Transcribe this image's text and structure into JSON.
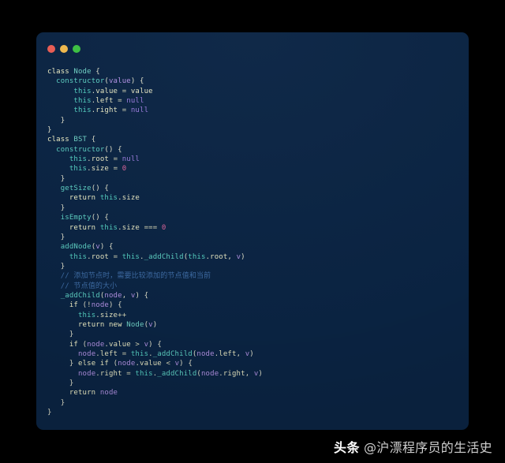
{
  "window": {
    "background_color": "#0b2545",
    "page_background_color": "#000000",
    "traffic_lights": [
      {
        "name": "close",
        "color": "#ef5f56"
      },
      {
        "name": "minimize",
        "color": "#f5bd4f"
      },
      {
        "name": "maximize",
        "color": "#3ec544"
      }
    ]
  },
  "editor": {
    "language": "javascript",
    "theme_colors": {
      "keyword": "#f2f2c8",
      "class_name": "#72d5c8",
      "function": "#5fd3c6",
      "this_object": "#56d3c4",
      "property": "#e9e9c4",
      "parameter": "#b694e8",
      "literal_null": "#9d7ee0",
      "number": "#e2689f",
      "comment": "#3f6ea8",
      "punctuation": "#e2e2cc"
    },
    "lines": [
      {
        "n": 1,
        "tokens": [
          {
            "t": "class",
            "c": "kw"
          },
          {
            "t": " ",
            "c": "plain"
          },
          {
            "t": "Node",
            "c": "cls"
          },
          {
            "t": " ",
            "c": "plain"
          },
          {
            "t": "{",
            "c": "punc"
          }
        ]
      },
      {
        "n": 2,
        "tokens": [
          {
            "t": "  ",
            "c": "plain"
          },
          {
            "t": "constructor",
            "c": "fn"
          },
          {
            "t": "(",
            "c": "punc"
          },
          {
            "t": "value",
            "c": "param"
          },
          {
            "t": ")",
            "c": "punc"
          },
          {
            "t": " ",
            "c": "plain"
          },
          {
            "t": "{",
            "c": "punc"
          }
        ]
      },
      {
        "n": 3,
        "tokens": [
          {
            "t": "      ",
            "c": "plain"
          },
          {
            "t": "this",
            "c": "obj"
          },
          {
            "t": ".",
            "c": "punc"
          },
          {
            "t": "value",
            "c": "prop"
          },
          {
            "t": " ",
            "c": "plain"
          },
          {
            "t": "=",
            "c": "op"
          },
          {
            "t": " ",
            "c": "plain"
          },
          {
            "t": "value",
            "c": "prop"
          }
        ]
      },
      {
        "n": 4,
        "tokens": [
          {
            "t": "      ",
            "c": "plain"
          },
          {
            "t": "this",
            "c": "obj"
          },
          {
            "t": ".",
            "c": "punc"
          },
          {
            "t": "left",
            "c": "prop"
          },
          {
            "t": " ",
            "c": "plain"
          },
          {
            "t": "=",
            "c": "op"
          },
          {
            "t": " ",
            "c": "plain"
          },
          {
            "t": "null",
            "c": "lit"
          }
        ]
      },
      {
        "n": 5,
        "tokens": [
          {
            "t": "      ",
            "c": "plain"
          },
          {
            "t": "this",
            "c": "obj"
          },
          {
            "t": ".",
            "c": "punc"
          },
          {
            "t": "right",
            "c": "prop"
          },
          {
            "t": " ",
            "c": "plain"
          },
          {
            "t": "=",
            "c": "op"
          },
          {
            "t": " ",
            "c": "plain"
          },
          {
            "t": "null",
            "c": "lit"
          }
        ]
      },
      {
        "n": 6,
        "tokens": [
          {
            "t": "   }",
            "c": "punc"
          }
        ]
      },
      {
        "n": 7,
        "tokens": [
          {
            "t": "}",
            "c": "punc"
          }
        ]
      },
      {
        "n": 8,
        "tokens": [
          {
            "t": "class",
            "c": "kw"
          },
          {
            "t": " ",
            "c": "plain"
          },
          {
            "t": "BST",
            "c": "cls"
          },
          {
            "t": " ",
            "c": "plain"
          },
          {
            "t": "{",
            "c": "punc"
          }
        ]
      },
      {
        "n": 9,
        "tokens": [
          {
            "t": "  ",
            "c": "plain"
          },
          {
            "t": "constructor",
            "c": "fn"
          },
          {
            "t": "(",
            "c": "punc"
          },
          {
            "t": ")",
            "c": "punc"
          },
          {
            "t": " ",
            "c": "plain"
          },
          {
            "t": "{",
            "c": "punc"
          }
        ]
      },
      {
        "n": 10,
        "tokens": [
          {
            "t": "     ",
            "c": "plain"
          },
          {
            "t": "this",
            "c": "obj"
          },
          {
            "t": ".",
            "c": "punc"
          },
          {
            "t": "root",
            "c": "prop"
          },
          {
            "t": " ",
            "c": "plain"
          },
          {
            "t": "=",
            "c": "op"
          },
          {
            "t": " ",
            "c": "plain"
          },
          {
            "t": "null",
            "c": "lit"
          }
        ]
      },
      {
        "n": 11,
        "tokens": [
          {
            "t": "     ",
            "c": "plain"
          },
          {
            "t": "this",
            "c": "obj"
          },
          {
            "t": ".",
            "c": "punc"
          },
          {
            "t": "size",
            "c": "prop"
          },
          {
            "t": " ",
            "c": "plain"
          },
          {
            "t": "=",
            "c": "op"
          },
          {
            "t": " ",
            "c": "plain"
          },
          {
            "t": "0",
            "c": "num"
          }
        ]
      },
      {
        "n": 12,
        "tokens": [
          {
            "t": "   }",
            "c": "punc"
          }
        ]
      },
      {
        "n": 13,
        "tokens": [
          {
            "t": "   ",
            "c": "plain"
          },
          {
            "t": "getSize",
            "c": "fn"
          },
          {
            "t": "()",
            "c": "punc"
          },
          {
            "t": " ",
            "c": "plain"
          },
          {
            "t": "{",
            "c": "punc"
          }
        ]
      },
      {
        "n": 14,
        "tokens": [
          {
            "t": "     ",
            "c": "plain"
          },
          {
            "t": "return",
            "c": "kw"
          },
          {
            "t": " ",
            "c": "plain"
          },
          {
            "t": "this",
            "c": "obj"
          },
          {
            "t": ".",
            "c": "punc"
          },
          {
            "t": "size",
            "c": "prop"
          }
        ]
      },
      {
        "n": 15,
        "tokens": [
          {
            "t": "   }",
            "c": "punc"
          }
        ]
      },
      {
        "n": 16,
        "tokens": [
          {
            "t": "   ",
            "c": "plain"
          },
          {
            "t": "isEmpty",
            "c": "fn"
          },
          {
            "t": "()",
            "c": "punc"
          },
          {
            "t": " ",
            "c": "plain"
          },
          {
            "t": "{",
            "c": "punc"
          }
        ]
      },
      {
        "n": 17,
        "tokens": [
          {
            "t": "     ",
            "c": "plain"
          },
          {
            "t": "return",
            "c": "kw"
          },
          {
            "t": " ",
            "c": "plain"
          },
          {
            "t": "this",
            "c": "obj"
          },
          {
            "t": ".",
            "c": "punc"
          },
          {
            "t": "size",
            "c": "prop"
          },
          {
            "t": " ",
            "c": "plain"
          },
          {
            "t": "===",
            "c": "op"
          },
          {
            "t": " ",
            "c": "plain"
          },
          {
            "t": "0",
            "c": "num"
          }
        ]
      },
      {
        "n": 18,
        "tokens": [
          {
            "t": "   }",
            "c": "punc"
          }
        ]
      },
      {
        "n": 19,
        "tokens": [
          {
            "t": "   ",
            "c": "plain"
          },
          {
            "t": "addNode",
            "c": "fn"
          },
          {
            "t": "(",
            "c": "punc"
          },
          {
            "t": "v",
            "c": "param"
          },
          {
            "t": ")",
            "c": "punc"
          },
          {
            "t": " ",
            "c": "plain"
          },
          {
            "t": "{",
            "c": "punc"
          }
        ]
      },
      {
        "n": 20,
        "tokens": [
          {
            "t": "     ",
            "c": "plain"
          },
          {
            "t": "this",
            "c": "obj"
          },
          {
            "t": ".",
            "c": "punc"
          },
          {
            "t": "root",
            "c": "prop"
          },
          {
            "t": " ",
            "c": "plain"
          },
          {
            "t": "=",
            "c": "op"
          },
          {
            "t": " ",
            "c": "plain"
          },
          {
            "t": "this",
            "c": "obj"
          },
          {
            "t": ".",
            "c": "punc"
          },
          {
            "t": "_addChild",
            "c": "fn"
          },
          {
            "t": "(",
            "c": "punc"
          },
          {
            "t": "this",
            "c": "obj"
          },
          {
            "t": ".",
            "c": "punc"
          },
          {
            "t": "root",
            "c": "prop"
          },
          {
            "t": ",",
            "c": "punc"
          },
          {
            "t": " ",
            "c": "plain"
          },
          {
            "t": "v",
            "c": "param"
          },
          {
            "t": ")",
            "c": "punc"
          }
        ]
      },
      {
        "n": 21,
        "tokens": [
          {
            "t": "   }",
            "c": "punc"
          }
        ]
      },
      {
        "n": 22,
        "tokens": [
          {
            "t": "   ",
            "c": "plain"
          },
          {
            "t": "// 添加节点时，需要比较添加的节点值和当前",
            "c": "cmt"
          }
        ]
      },
      {
        "n": 23,
        "tokens": [
          {
            "t": "   ",
            "c": "plain"
          },
          {
            "t": "// 节点值的大小",
            "c": "cmt"
          }
        ]
      },
      {
        "n": 24,
        "tokens": [
          {
            "t": "   ",
            "c": "plain"
          },
          {
            "t": "_addChild",
            "c": "fn"
          },
          {
            "t": "(",
            "c": "punc"
          },
          {
            "t": "node",
            "c": "param"
          },
          {
            "t": ",",
            "c": "punc"
          },
          {
            "t": " ",
            "c": "plain"
          },
          {
            "t": "v",
            "c": "param"
          },
          {
            "t": ")",
            "c": "punc"
          },
          {
            "t": " ",
            "c": "plain"
          },
          {
            "t": "{",
            "c": "punc"
          }
        ]
      },
      {
        "n": 25,
        "tokens": [
          {
            "t": "     ",
            "c": "plain"
          },
          {
            "t": "if",
            "c": "kw"
          },
          {
            "t": " ",
            "c": "plain"
          },
          {
            "t": "(",
            "c": "punc"
          },
          {
            "t": "!",
            "c": "op"
          },
          {
            "t": "node",
            "c": "param"
          },
          {
            "t": ")",
            "c": "punc"
          },
          {
            "t": " ",
            "c": "plain"
          },
          {
            "t": "{",
            "c": "punc"
          }
        ]
      },
      {
        "n": 26,
        "tokens": [
          {
            "t": "       ",
            "c": "plain"
          },
          {
            "t": "this",
            "c": "obj"
          },
          {
            "t": ".",
            "c": "punc"
          },
          {
            "t": "size",
            "c": "prop"
          },
          {
            "t": "++",
            "c": "op"
          }
        ]
      },
      {
        "n": 27,
        "tokens": [
          {
            "t": "       ",
            "c": "plain"
          },
          {
            "t": "return",
            "c": "kw"
          },
          {
            "t": " ",
            "c": "plain"
          },
          {
            "t": "new",
            "c": "kw"
          },
          {
            "t": " ",
            "c": "plain"
          },
          {
            "t": "Node",
            "c": "cls"
          },
          {
            "t": "(",
            "c": "punc"
          },
          {
            "t": "v",
            "c": "param"
          },
          {
            "t": ")",
            "c": "punc"
          }
        ]
      },
      {
        "n": 28,
        "tokens": [
          {
            "t": "     }",
            "c": "punc"
          }
        ]
      },
      {
        "n": 29,
        "tokens": [
          {
            "t": "     ",
            "c": "plain"
          },
          {
            "t": "if",
            "c": "kw"
          },
          {
            "t": " ",
            "c": "plain"
          },
          {
            "t": "(",
            "c": "punc"
          },
          {
            "t": "node",
            "c": "param"
          },
          {
            "t": ".",
            "c": "punc"
          },
          {
            "t": "value",
            "c": "prop"
          },
          {
            "t": " ",
            "c": "plain"
          },
          {
            "t": ">",
            "c": "op"
          },
          {
            "t": " ",
            "c": "plain"
          },
          {
            "t": "v",
            "c": "param"
          },
          {
            "t": ")",
            "c": "punc"
          },
          {
            "t": " ",
            "c": "plain"
          },
          {
            "t": "{",
            "c": "punc"
          }
        ]
      },
      {
        "n": 30,
        "tokens": [
          {
            "t": "       ",
            "c": "plain"
          },
          {
            "t": "node",
            "c": "param"
          },
          {
            "t": ".",
            "c": "punc"
          },
          {
            "t": "left",
            "c": "prop"
          },
          {
            "t": " ",
            "c": "plain"
          },
          {
            "t": "=",
            "c": "op"
          },
          {
            "t": " ",
            "c": "plain"
          },
          {
            "t": "this",
            "c": "obj"
          },
          {
            "t": ".",
            "c": "punc"
          },
          {
            "t": "_addChild",
            "c": "fn"
          },
          {
            "t": "(",
            "c": "punc"
          },
          {
            "t": "node",
            "c": "param"
          },
          {
            "t": ".",
            "c": "punc"
          },
          {
            "t": "left",
            "c": "prop"
          },
          {
            "t": ",",
            "c": "punc"
          },
          {
            "t": " ",
            "c": "plain"
          },
          {
            "t": "v",
            "c": "param"
          },
          {
            "t": ")",
            "c": "punc"
          }
        ]
      },
      {
        "n": 31,
        "tokens": [
          {
            "t": "     }",
            "c": "punc"
          },
          {
            "t": " ",
            "c": "plain"
          },
          {
            "t": "else",
            "c": "kw"
          },
          {
            "t": " ",
            "c": "plain"
          },
          {
            "t": "if",
            "c": "kw"
          },
          {
            "t": " ",
            "c": "plain"
          },
          {
            "t": "(",
            "c": "punc"
          },
          {
            "t": "node",
            "c": "param"
          },
          {
            "t": ".",
            "c": "punc"
          },
          {
            "t": "value",
            "c": "prop"
          },
          {
            "t": " ",
            "c": "plain"
          },
          {
            "t": "<",
            "c": "op"
          },
          {
            "t": " ",
            "c": "plain"
          },
          {
            "t": "v",
            "c": "param"
          },
          {
            "t": ")",
            "c": "punc"
          },
          {
            "t": " ",
            "c": "plain"
          },
          {
            "t": "{",
            "c": "punc"
          }
        ]
      },
      {
        "n": 32,
        "tokens": [
          {
            "t": "       ",
            "c": "plain"
          },
          {
            "t": "node",
            "c": "param"
          },
          {
            "t": ".",
            "c": "punc"
          },
          {
            "t": "right",
            "c": "prop"
          },
          {
            "t": " ",
            "c": "plain"
          },
          {
            "t": "=",
            "c": "op"
          },
          {
            "t": " ",
            "c": "plain"
          },
          {
            "t": "this",
            "c": "obj"
          },
          {
            "t": ".",
            "c": "punc"
          },
          {
            "t": "_addChild",
            "c": "fn"
          },
          {
            "t": "(",
            "c": "punc"
          },
          {
            "t": "node",
            "c": "param"
          },
          {
            "t": ".",
            "c": "punc"
          },
          {
            "t": "right",
            "c": "prop"
          },
          {
            "t": ",",
            "c": "punc"
          },
          {
            "t": " ",
            "c": "plain"
          },
          {
            "t": "v",
            "c": "param"
          },
          {
            "t": ")",
            "c": "punc"
          }
        ]
      },
      {
        "n": 33,
        "tokens": [
          {
            "t": "     }",
            "c": "punc"
          }
        ]
      },
      {
        "n": 34,
        "tokens": [
          {
            "t": "     ",
            "c": "plain"
          },
          {
            "t": "return",
            "c": "kw"
          },
          {
            "t": " ",
            "c": "plain"
          },
          {
            "t": "node",
            "c": "param"
          }
        ]
      },
      {
        "n": 35,
        "tokens": [
          {
            "t": "   }",
            "c": "punc"
          }
        ]
      },
      {
        "n": 36,
        "tokens": [
          {
            "t": "}",
            "c": "punc"
          }
        ]
      }
    ]
  },
  "footer": {
    "brand": "头条",
    "handle": "@沪漂程序员的生活史"
  }
}
